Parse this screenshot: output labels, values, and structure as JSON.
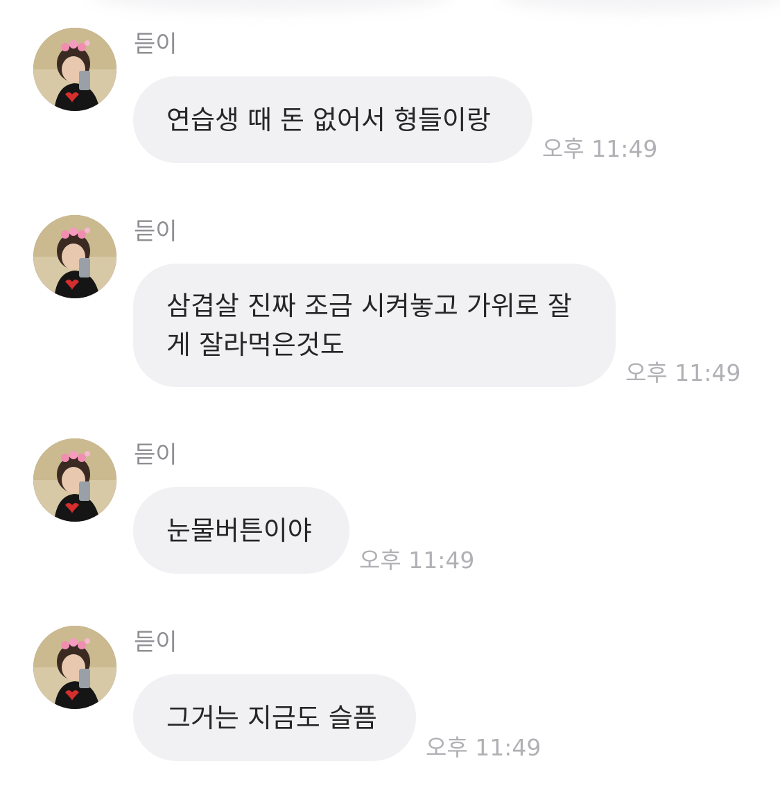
{
  "messages": [
    {
      "sender": "듣이",
      "text": "연습생 때 돈 없어서 형들이랑",
      "time": "오후 11:49"
    },
    {
      "sender": "듣이",
      "text": "삼겹살 진짜 조금 시켜놓고 가위로 잘\n게 잘라먹은것도",
      "time": "오후 11:49"
    },
    {
      "sender": "듣이",
      "text": "눈물버튼이야",
      "time": "오후 11:49"
    },
    {
      "sender": "듣이",
      "text": "그거는 지금도 슬픔",
      "time": "오후 11:49"
    }
  ],
  "avatar_icon": "profile-photo",
  "colors": {
    "bubble": "#f1f1f4",
    "text": "#262626",
    "sender": "#8e8e93",
    "time": "#b0b0b5"
  }
}
